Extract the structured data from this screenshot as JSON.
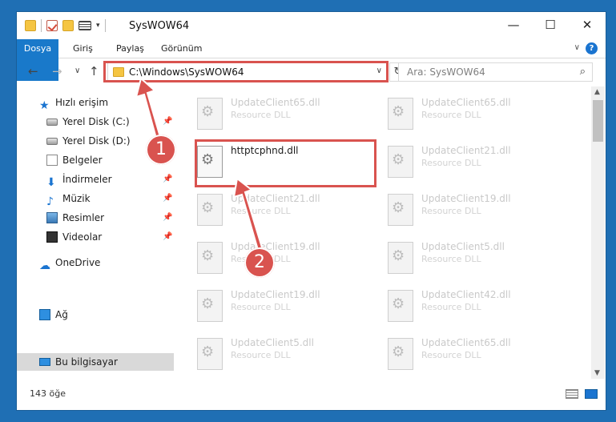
{
  "window": {
    "title": "SysWOW64",
    "controls": {
      "minimize": "—",
      "maximize": "☐",
      "close": "✕"
    }
  },
  "ribbon": {
    "tabs": [
      "Dosya",
      "Giriş",
      "Paylaş",
      "Görünüm"
    ],
    "help_label": "?"
  },
  "address": {
    "path": "C:\\Windows\\SysWOW64",
    "search_placeholder": "Ara: SysWOW64"
  },
  "nav": {
    "quick_access": "Hızlı erişim",
    "items": [
      {
        "label": "Yerel Disk (C:)",
        "icon": "drive-icon",
        "pinned": true
      },
      {
        "label": "Yerel Disk (D:)",
        "icon": "drive-icon",
        "pinned": false
      },
      {
        "label": "Belgeler",
        "icon": "documents-icon",
        "pinned": false
      },
      {
        "label": "İndirmeler",
        "icon": "downloads-icon",
        "pinned": true
      },
      {
        "label": "Müzik",
        "icon": "music-icon",
        "pinned": true
      },
      {
        "label": "Resimler",
        "icon": "pictures-icon",
        "pinned": true
      },
      {
        "label": "Videolar",
        "icon": "videos-icon",
        "pinned": true
      }
    ],
    "onedrive": "OneDrive",
    "this_pc": "Bu bilgisayar",
    "network": "Ağ"
  },
  "files": {
    "col1": [
      {
        "name": "UpdateClient65.dll",
        "type": "Resource DLL"
      },
      {
        "name": "httptcphnd.dll",
        "type": ""
      },
      {
        "name": "UpdateClient21.dll",
        "type": "Resource DLL"
      },
      {
        "name": "UpdateClient19.dll",
        "type": "Resource DLL"
      },
      {
        "name": "UpdateClient19.dll",
        "type": "Resource DLL"
      },
      {
        "name": "UpdateClient5.dll",
        "type": "Resource DLL"
      }
    ],
    "col2": [
      {
        "name": "UpdateClient65.dll",
        "type": "Resource DLL"
      },
      {
        "name": "UpdateClient21.dll",
        "type": "Resource DLL"
      },
      {
        "name": "UpdateClient19.dll",
        "type": "Resource DLL"
      },
      {
        "name": "UpdateClient5.dll",
        "type": "Resource DLL"
      },
      {
        "name": "UpdateClient42.dll",
        "type": "Resource DLL"
      },
      {
        "name": "UpdateClient65.dll",
        "type": "Resource DLL"
      }
    ]
  },
  "status": {
    "count": "143 öğe"
  },
  "annotations": {
    "badge1": "1",
    "badge2": "2",
    "color": "#d9534f"
  }
}
